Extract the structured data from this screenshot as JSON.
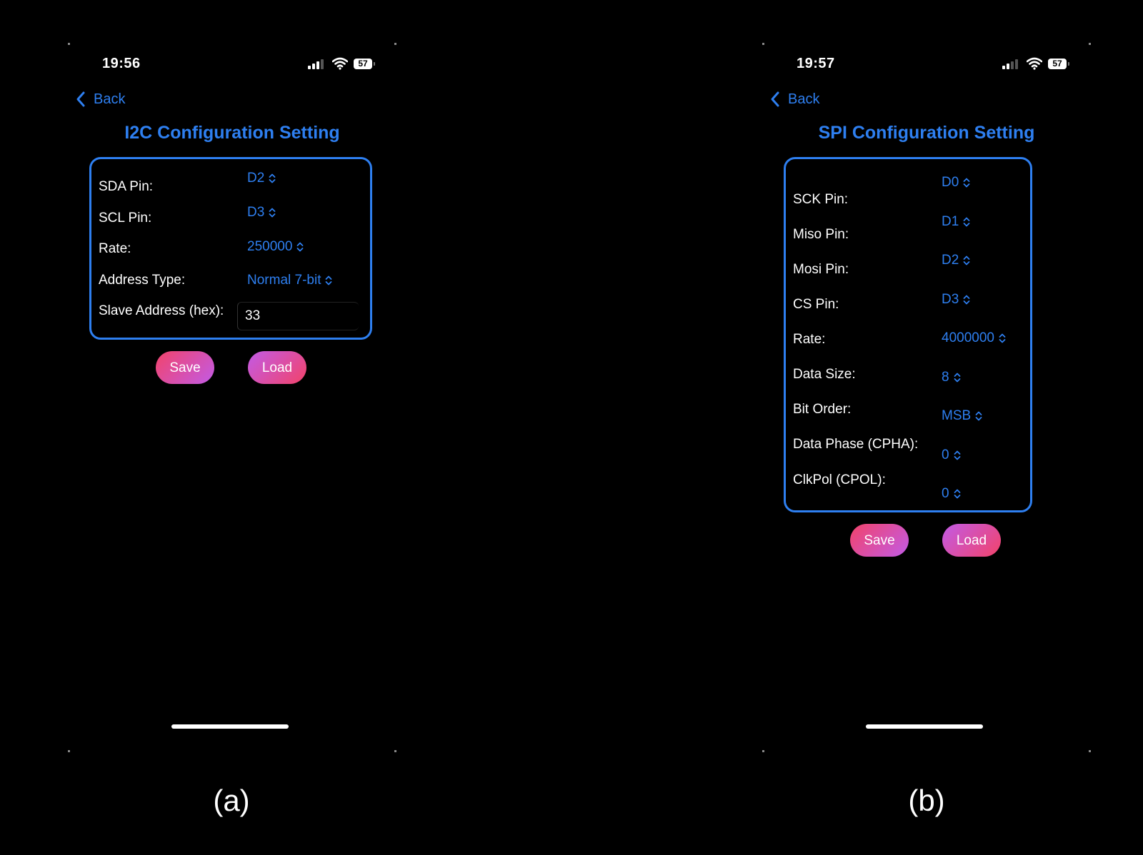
{
  "phone_a": {
    "time": "19:56",
    "battery": "57",
    "back_label": "Back",
    "title": "I2C Configuration Setting",
    "fields": [
      {
        "label": "SDA Pin:",
        "value": "D2"
      },
      {
        "label": "SCL Pin:",
        "value": "D3"
      },
      {
        "label": "Rate:",
        "value": "250000"
      },
      {
        "label": "Address Type:",
        "value": "Normal 7-bit"
      }
    ],
    "slave_address": {
      "label": "Slave Address (hex):",
      "value": "33"
    },
    "save_label": "Save",
    "load_label": "Load"
  },
  "phone_b": {
    "time": "19:57",
    "battery": "57",
    "back_label": "Back",
    "title": "SPI Configuration Setting",
    "fields": [
      {
        "label": "SCK Pin:",
        "value": "D0"
      },
      {
        "label": "Miso Pin:",
        "value": "D1"
      },
      {
        "label": "Mosi Pin:",
        "value": "D2"
      },
      {
        "label": "CS Pin:",
        "value": "D3"
      },
      {
        "label": "Rate:",
        "value": "4000000"
      },
      {
        "label": "Data Size:",
        "value": "8"
      },
      {
        "label": "Bit Order:",
        "value": "MSB"
      },
      {
        "label": "Data Phase (CPHA):",
        "value": "0"
      },
      {
        "label": "ClkPol (CPOL):",
        "value": "0"
      }
    ],
    "save_label": "Save",
    "load_label": "Load"
  },
  "captions": {
    "a": "(a)",
    "b": "(b)"
  },
  "colors": {
    "accent": "#2e7ff0",
    "button_gradient_start": "#f2436a",
    "button_gradient_end": "#c25be6",
    "background": "#000000"
  }
}
